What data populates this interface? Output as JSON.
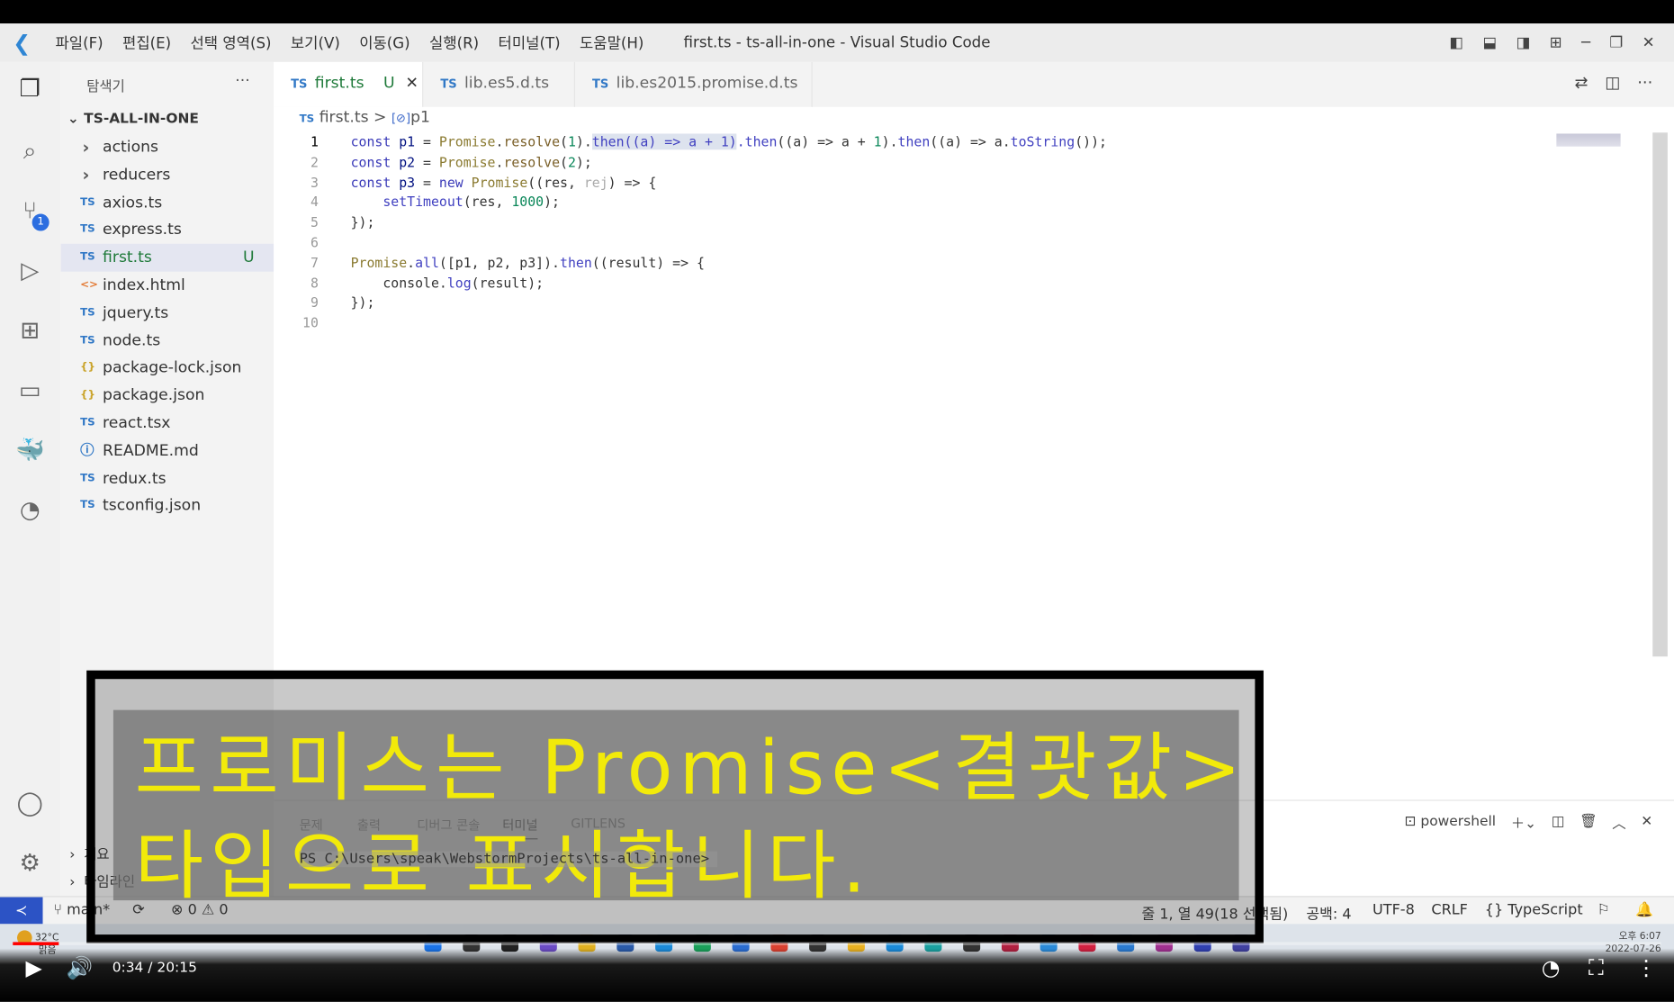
{
  "window": {
    "title": "first.ts - ts-all-in-one - Visual Studio Code"
  },
  "menu": [
    "파일(F)",
    "편집(E)",
    "선택 영역(S)",
    "보기(V)",
    "이동(G)",
    "실행(R)",
    "터미널(T)",
    "도움말(H)"
  ],
  "sidebar": {
    "title": "탐색기",
    "more": "···",
    "root": "TS-ALL-IN-ONE",
    "items": [
      {
        "label": "actions",
        "type": "folder",
        "icon": "chevron-right"
      },
      {
        "label": "reducers",
        "type": "folder",
        "icon": "chevron-right"
      },
      {
        "label": "axios.ts",
        "icon": "TS"
      },
      {
        "label": "express.ts",
        "icon": "TS"
      },
      {
        "label": "first.ts",
        "icon": "TS",
        "badge": "U",
        "selected": true
      },
      {
        "label": "index.html",
        "icon": "<>"
      },
      {
        "label": "jquery.ts",
        "icon": "TS"
      },
      {
        "label": "node.ts",
        "icon": "TS"
      },
      {
        "label": "package-lock.json",
        "icon": "{}"
      },
      {
        "label": "package.json",
        "icon": "{}"
      },
      {
        "label": "react.tsx",
        "icon": "TS"
      },
      {
        "label": "README.md",
        "icon": "ⓘ"
      },
      {
        "label": "redux.ts",
        "icon": "TS"
      },
      {
        "label": "tsconfig.json",
        "icon": "TS"
      }
    ],
    "sections": [
      "개요",
      "타임라인"
    ]
  },
  "activity": {
    "scm_badge": "1"
  },
  "tabs": [
    {
      "icon": "TS",
      "label": "first.ts",
      "badge": "U",
      "close": "✕",
      "active": true
    },
    {
      "icon": "TS",
      "label": "lib.es5.d.ts"
    },
    {
      "icon": "TS",
      "label": "lib.es2015.promise.d.ts"
    }
  ],
  "breadcrumb": {
    "icon": "TS",
    "file": "first.ts",
    "sep": ">",
    "symbol_icon": "[⊘]",
    "symbol": "p1"
  },
  "code": [
    [
      [
        "const ",
        "kw"
      ],
      [
        "p1",
        "var"
      ],
      [
        " = ",
        "op"
      ],
      [
        "Promise",
        "typ"
      ],
      [
        ".",
        "pun"
      ],
      [
        "resolve",
        "fn"
      ],
      [
        "(",
        "pun"
      ],
      [
        "1",
        "num"
      ],
      [
        ").",
        "pun"
      ],
      [
        "then((a) => a + 1)",
        "then sel-hl"
      ],
      [
        ".then",
        "then"
      ],
      [
        "((a) => a + ",
        "pun"
      ],
      [
        "1",
        "num"
      ],
      [
        ").",
        "pun"
      ],
      [
        "then",
        "then"
      ],
      [
        "((a) => a.",
        "pun"
      ],
      [
        "toString",
        "then"
      ],
      [
        "());",
        "pun"
      ]
    ],
    [
      [
        "const ",
        "kw"
      ],
      [
        "p2",
        "var"
      ],
      [
        " = ",
        "op"
      ],
      [
        "Promise",
        "typ"
      ],
      [
        ".",
        "pun"
      ],
      [
        "resolve",
        "fn"
      ],
      [
        "(",
        "pun"
      ],
      [
        "2",
        "num"
      ],
      [
        ");",
        "pun"
      ]
    ],
    [
      [
        "const ",
        "kw"
      ],
      [
        "p3",
        "var"
      ],
      [
        " = ",
        "op"
      ],
      [
        "new ",
        "kw"
      ],
      [
        "Promise",
        "typ"
      ],
      [
        "((res, ",
        "pun"
      ],
      [
        "rej",
        "gray"
      ],
      [
        ") => {",
        "pun"
      ]
    ],
    [
      [
        "    setTimeout",
        "then"
      ],
      [
        "(res, ",
        "pun"
      ],
      [
        "1000",
        "num"
      ],
      [
        ");",
        "pun"
      ]
    ],
    [
      [
        "});",
        "pun"
      ]
    ],
    [],
    [
      [
        "Promise",
        "typ"
      ],
      [
        ".",
        "pun"
      ],
      [
        "all",
        "then"
      ],
      [
        "([p1, p2, p3]).",
        "pun"
      ],
      [
        "then",
        "then"
      ],
      [
        "((result) => {",
        "pun"
      ]
    ],
    [
      [
        "    console.",
        "pun"
      ],
      [
        "log",
        "then"
      ],
      [
        "(result);",
        "pun"
      ]
    ],
    [
      [
        "});",
        "pun"
      ]
    ],
    []
  ],
  "panel": {
    "tabs": [
      "문제",
      "출력",
      "디버그 콘솔",
      "터미널",
      "GITLENS"
    ],
    "active_tab": "터미널",
    "terminal_line": "PS C:\\Users\\speak\\WebstormProjects\\ts-all-in-one> ",
    "shell": "powershell"
  },
  "statusbar": {
    "branch": "main*",
    "errors": "0",
    "warnings": "0",
    "position": "줄 1, 열 49(18 선택됨)",
    "spaces": "공백: 4",
    "encoding": "UTF-8",
    "eol": "CRLF",
    "language": "{} TypeScript"
  },
  "taskbar": {
    "temp": "32°C",
    "weather": "맑음",
    "time": "오후 6:07",
    "date": "2022-07-26"
  },
  "video": {
    "time": "0:34 / 20:15",
    "progress": 0.028
  },
  "subtitle": {
    "line1": "프로미스는 Promise<결괏값>",
    "line2": "타입으로 표시합니다."
  }
}
